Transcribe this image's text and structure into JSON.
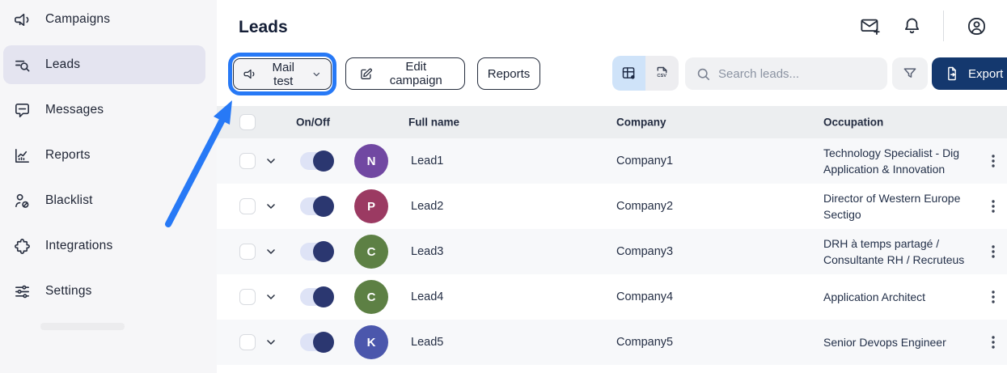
{
  "colors": {
    "annotation_blue": "#2779f6",
    "export_button_bg": "#14386e",
    "toggle_on": "#2b3770",
    "sidebar_active_bg": "#e4e4f0",
    "view_toggle_active_bg": "#cfe3f9",
    "table_header_bg": "#eceef0",
    "row_stripe_bg": "#f7f8fa"
  },
  "sidebar": {
    "items": [
      {
        "label": "Campaigns",
        "icon": "megaphone-icon",
        "active": false
      },
      {
        "label": "Leads",
        "icon": "leads-search-icon",
        "active": true
      },
      {
        "label": "Messages",
        "icon": "message-icon",
        "active": false
      },
      {
        "label": "Reports",
        "icon": "bar-chart-icon",
        "active": false
      },
      {
        "label": "Blacklist",
        "icon": "user-block-icon",
        "active": false
      },
      {
        "label": "Integrations",
        "icon": "puzzle-icon",
        "active": false
      },
      {
        "label": "Settings",
        "icon": "sliders-icon",
        "active": false
      }
    ]
  },
  "topbar": {
    "title": "Leads",
    "icons": [
      "mail-plus-icon",
      "bell-icon",
      "profile-icon"
    ]
  },
  "toolbar": {
    "campaign_selector_label": "Mail test",
    "edit_campaign_label": "Edit campaign",
    "reports_label": "Reports",
    "search_placeholder": "Search leads...",
    "export_label": "Export data",
    "csv_icon_text": "CSV"
  },
  "table": {
    "columns": {
      "on_off": "On/Off",
      "full_name": "Full name",
      "company": "Company",
      "occupation": "Occupation"
    },
    "rows": [
      {
        "name": "Lead1",
        "company": "Company1",
        "occupation_lines": [
          "Technology Specialist - Dig",
          "Application & Innovation"
        ],
        "initial": "N",
        "avatar_color": "#7148a2",
        "enabled": true
      },
      {
        "name": "Lead2",
        "company": "Company2",
        "occupation_lines": [
          "Director of Western Europe",
          "Sectigo"
        ],
        "initial": "P",
        "avatar_color": "#9b3a62",
        "enabled": true
      },
      {
        "name": "Lead3",
        "company": "Company3",
        "occupation_lines": [
          "DRH à temps partagé /",
          "Consultante RH / Recruteus"
        ],
        "initial": "C",
        "avatar_color": "#5d8044",
        "enabled": true
      },
      {
        "name": "Lead4",
        "company": "Company4",
        "occupation_lines": [
          "Application Architect"
        ],
        "initial": "C",
        "avatar_color": "#5d8044",
        "enabled": true
      },
      {
        "name": "Lead5",
        "company": "Company5",
        "occupation_lines": [
          "Senior Devops Engineer"
        ],
        "initial": "K",
        "avatar_color": "#4b57ac",
        "enabled": true
      }
    ]
  }
}
